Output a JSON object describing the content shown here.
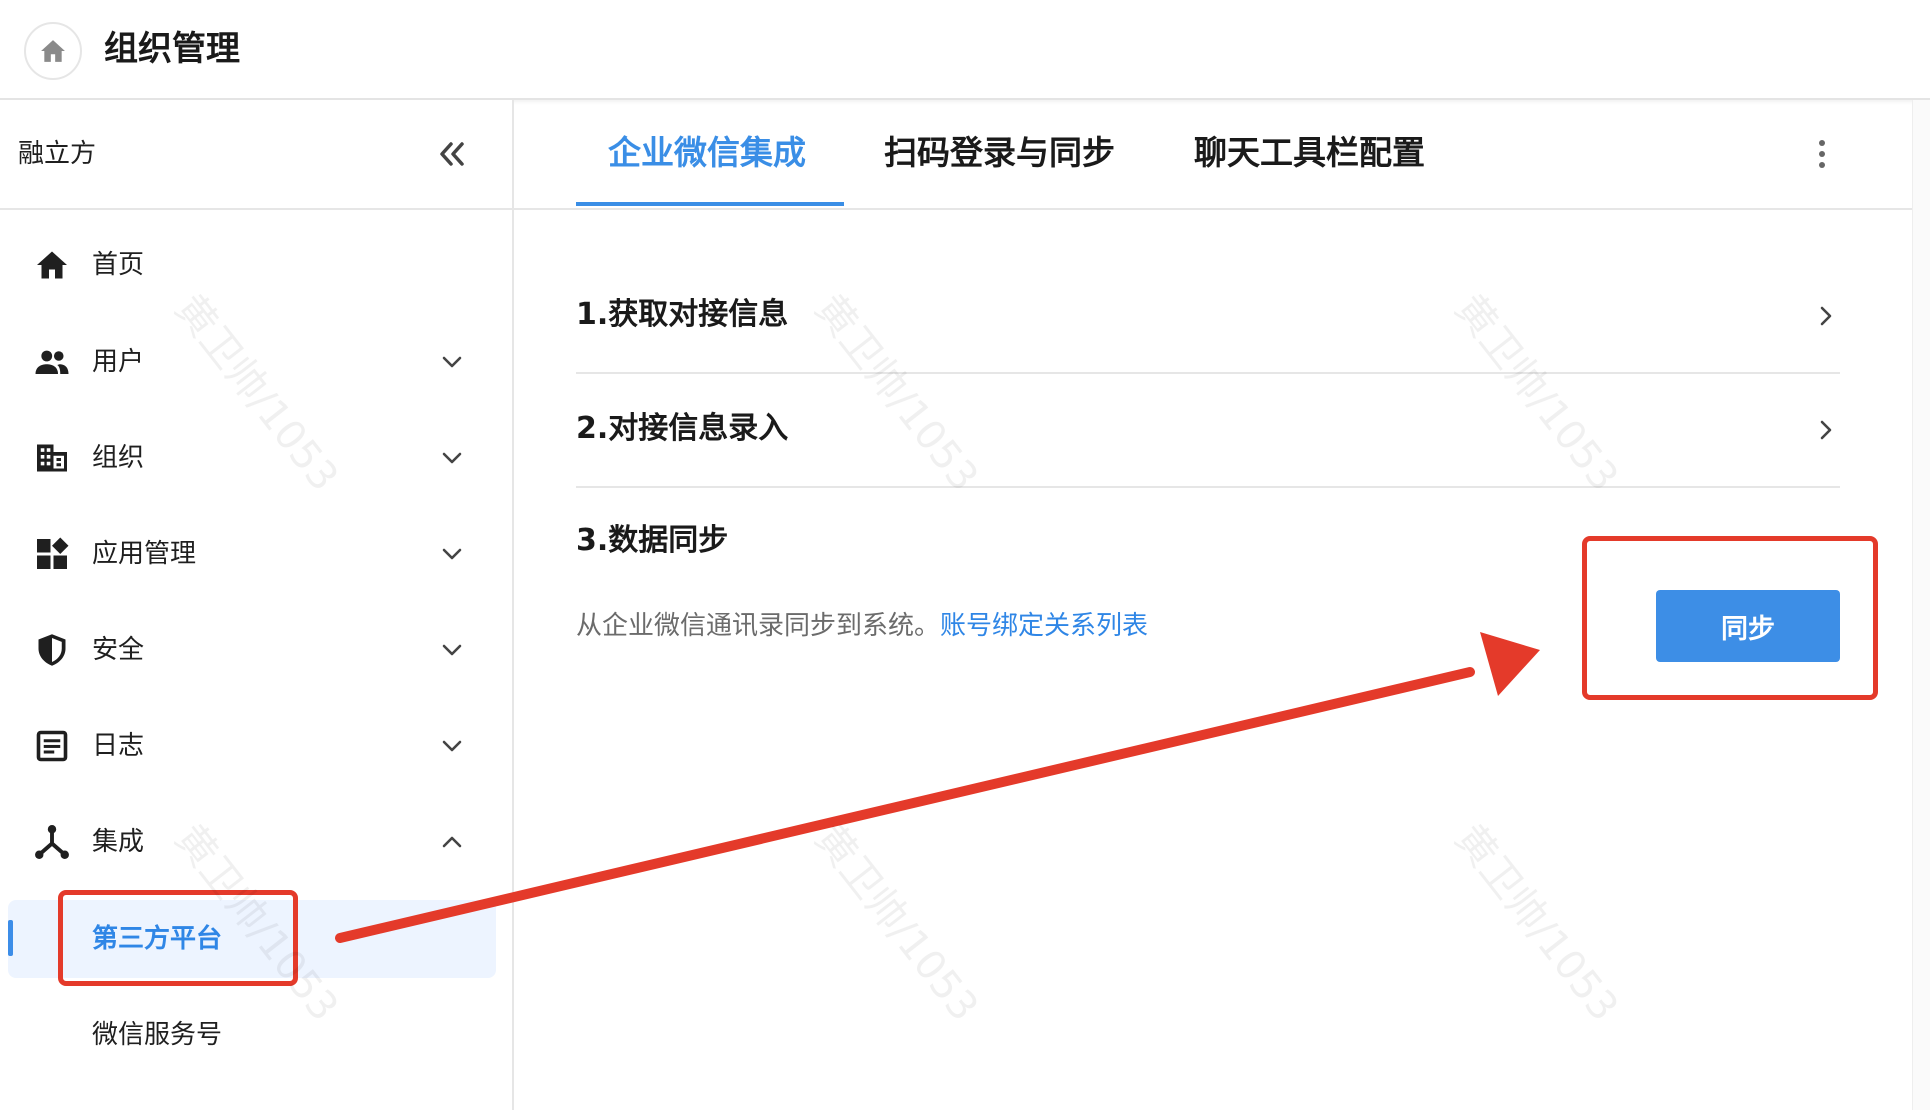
{
  "header": {
    "title": "组织管理",
    "home_icon": "home-icon"
  },
  "sidebar": {
    "org_name": "融立方",
    "collapse_icon": "double-chevron-left-icon",
    "items": [
      {
        "label": "首页",
        "icon": "home-icon"
      },
      {
        "label": "用户",
        "icon": "users-icon",
        "expandable": true
      },
      {
        "label": "组织",
        "icon": "building-icon",
        "expandable": true
      },
      {
        "label": "应用管理",
        "icon": "apps-icon",
        "expandable": true
      },
      {
        "label": "安全",
        "icon": "shield-icon",
        "expandable": true
      },
      {
        "label": "日志",
        "icon": "log-icon",
        "expandable": true
      },
      {
        "label": "集成",
        "icon": "integration-icon",
        "expanded": true
      }
    ],
    "sub_items": [
      {
        "label": "第三方平台",
        "active": true
      },
      {
        "label": "微信服务号",
        "active": false
      }
    ]
  },
  "tabs": [
    {
      "label": "企业微信集成",
      "active": true
    },
    {
      "label": "扫码登录与同步",
      "active": false
    },
    {
      "label": "聊天工具栏配置",
      "active": false
    }
  ],
  "sections": [
    {
      "title": "1.获取对接信息"
    },
    {
      "title": "2.对接信息录入"
    },
    {
      "title": "3.数据同步"
    }
  ],
  "sync": {
    "description": "从企业微信通讯录同步到系统。",
    "link": "账号绑定关系列表",
    "button": "同步"
  },
  "watermark": "黄卫帅/1053",
  "colors": {
    "accent": "#3a8ee6",
    "annotation": "#e43a2a",
    "active_bg": "#edf4ff"
  }
}
